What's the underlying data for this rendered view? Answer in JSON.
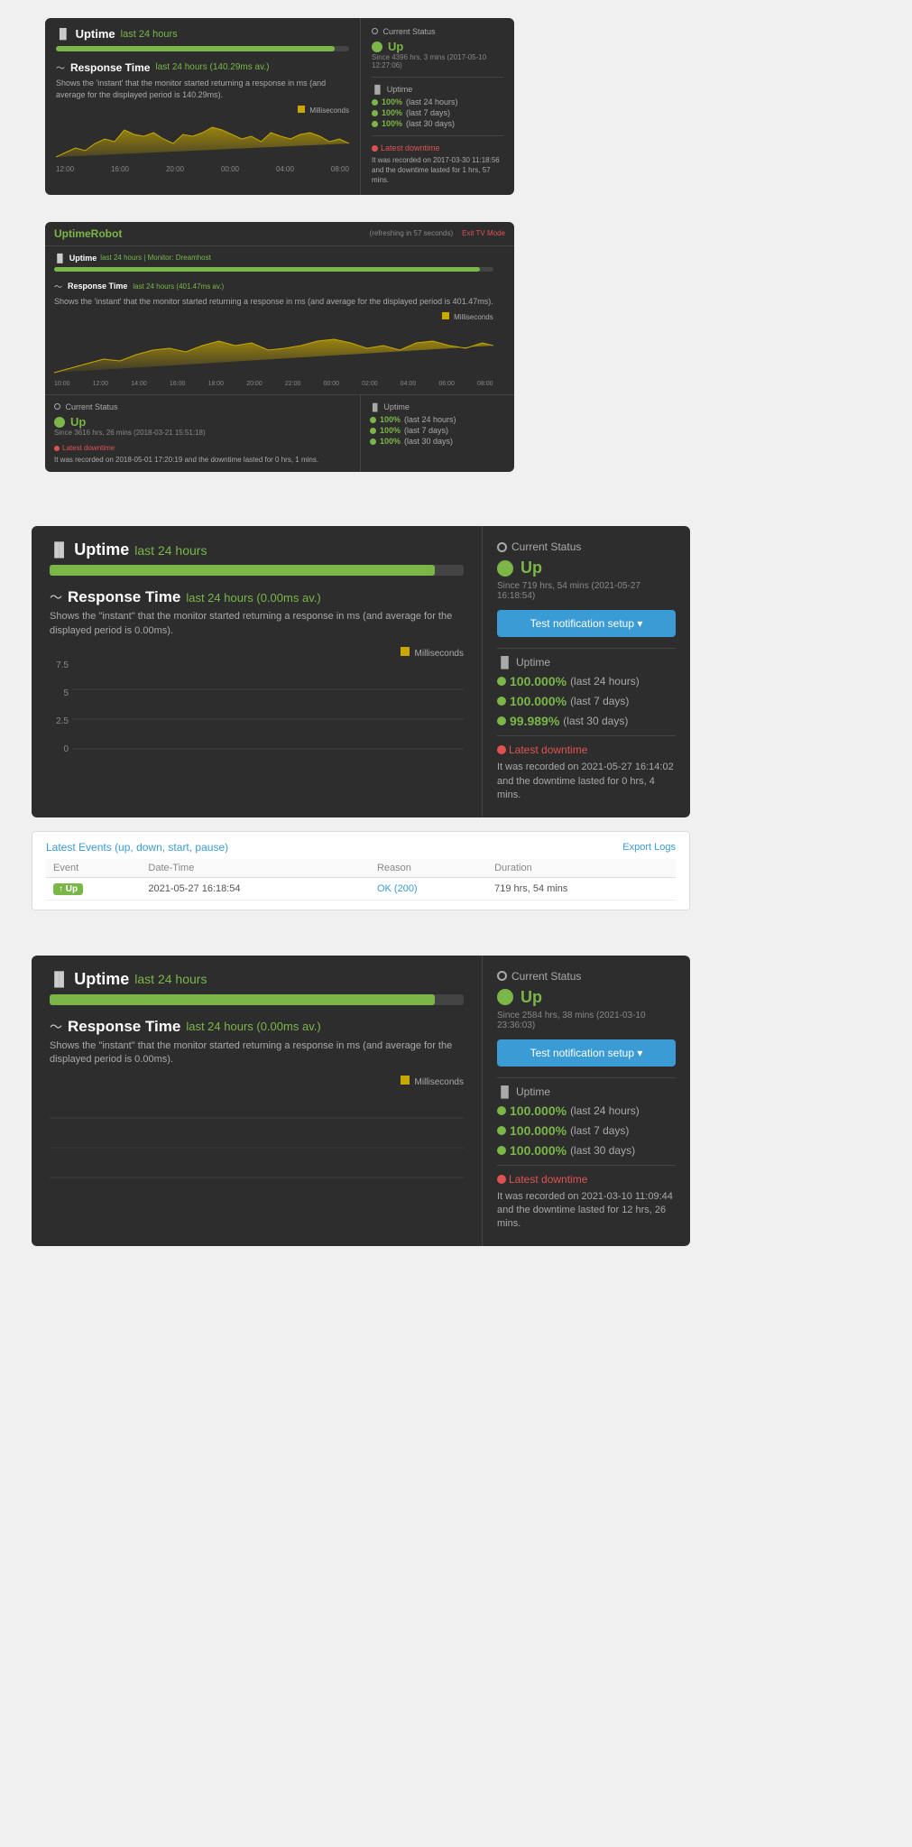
{
  "card1": {
    "uptime_title": "Uptime",
    "uptime_subtitle": "last 24 hours",
    "bar_width": "95%",
    "response_title": "Response Time",
    "response_subtitle": "last 24 hours (140.29ms av.)",
    "response_desc": "Shows the 'instant' that the monitor started returning a response in ms (and average for the displayed period is 140.29ms).",
    "ms_label": "Milliseconds",
    "chart_labels": [
      "12:00",
      "16:00",
      "20:00",
      "00:00",
      "04:00",
      "08:00"
    ],
    "current_status": "Current Status",
    "status": "Up",
    "since": "Since 4396 hrs, 3 mins (2017-05-10 12:27:06)",
    "uptime_section": "Uptime",
    "stats": [
      {
        "percent": "100%",
        "period": "(last 24 hours)"
      },
      {
        "percent": "100%",
        "period": "(last 7 days)"
      },
      {
        "percent": "100%",
        "period": "(last 30 days)"
      }
    ],
    "latest_downtime": "Latest downtime",
    "downtime_desc": "It was recorded on 2017-03-30 11:18:56 and the downtime lasted for 1 hrs, 57 mins."
  },
  "card2": {
    "logo": "UptimeRobot",
    "refreshing": "(refreshing in 57 seconds)",
    "exit_tv": "Exit TV Mode",
    "monitor": "Monitor: Dreamhost",
    "uptime_title": "Uptime",
    "uptime_subtitle": "last 24 hours",
    "bar_width": "97%",
    "response_title": "Response Time",
    "response_subtitle": "last 24 hours (401.47ms av.)",
    "response_desc": "Shows the 'instant' that the monitor started returning a response in ms (and average for the displayed period is 401.47ms).",
    "ms_label": "Milliseconds",
    "chart_labels": [
      "10:00",
      "12:00",
      "14:00",
      "16:00",
      "18:00",
      "20:00",
      "22:00",
      "00:00",
      "02:00",
      "04:00",
      "06:00",
      "08:00"
    ],
    "current_status": "Current Status",
    "status": "Up",
    "since": "Since 3616 hrs, 26 mins (2018-03-21 15:51:18)",
    "uptime_section": "Uptime",
    "stats": [
      {
        "percent": "100%",
        "period": "(last 24 hours)"
      },
      {
        "percent": "100%",
        "period": "(last 7 days)"
      },
      {
        "percent": "100%",
        "period": "(last 30 days)"
      }
    ],
    "latest_downtime": "Latest downtime",
    "downtime_desc": "It was recorded on 2018-05-01 17:20:19 and the downtime lasted for 0 hrs, 1 mins."
  },
  "card3": {
    "uptime_title": "Uptime",
    "uptime_subtitle": "last 24 hours",
    "bar_width": "93%",
    "response_title": "Response Time",
    "response_subtitle": "last 24 hours (0.00ms av.)",
    "response_desc": "Shows the \"instant\" that the monitor started returning a response in ms (and average for the displayed period is 0.00ms).",
    "ms_label": "Milliseconds",
    "y_labels": [
      "7.5",
      "5",
      "2.5",
      "0"
    ],
    "chart_labels": [],
    "current_status": "Current Status",
    "status": "Up",
    "since": "Since 719 hrs, 54 mins (2021-05-27 16:18:54)",
    "notification_btn": "Test notification setup ▾",
    "uptime_section": "Uptime",
    "stats": [
      {
        "percent": "100.000%",
        "period": "(last 24 hours)"
      },
      {
        "percent": "100.000%",
        "period": "(last 7 days)"
      },
      {
        "percent": "99.989%",
        "period": "(last 30 days)"
      }
    ],
    "latest_downtime": "Latest downtime",
    "downtime_desc": "It was recorded on 2021-05-27 16:14:02 and the downtime lasted for 0 hrs, 4 mins.",
    "events_title": "Latest Events",
    "events_filter": "(up, down, start, pause)",
    "export_logs": "Export Logs",
    "table_headers": [
      "Event",
      "Date-Time",
      "Reason",
      "Duration"
    ],
    "table_rows": [
      {
        "event": "Up",
        "datetime": "2021-05-27 16:18:54",
        "reason": "OK (200)",
        "duration": "719 hrs, 54 mins"
      }
    ]
  },
  "card4": {
    "uptime_title": "Uptime",
    "uptime_subtitle": "last 24 hours",
    "bar_width": "93%",
    "response_title": "Response Time",
    "response_subtitle": "last 24 hours (0.00ms av.)",
    "response_desc": "Shows the \"instant\" that the monitor started returning a response in ms (and average for the displayed period is 0.00ms).",
    "ms_label": "Milliseconds",
    "y_labels": [],
    "chart_labels": [],
    "current_status": "Current Status",
    "status": "Up",
    "since": "Since 2584 hrs, 38 mins (2021-03-10 23:36:03)",
    "notification_btn": "Test notification setup ▾",
    "uptime_section": "Uptime",
    "stats": [
      {
        "percent": "100.000%",
        "period": "(last 24 hours)"
      },
      {
        "percent": "100.000%",
        "period": "(last 7 days)"
      },
      {
        "percent": "100.000%",
        "period": "(last 30 days)"
      }
    ],
    "latest_downtime": "Latest downtime",
    "downtime_desc": "It was recorded on 2021-03-10 11:09:44 and the downtime lasted for 12 hrs, 26 mins."
  },
  "icons": {
    "bar_chart": "📊",
    "wave": "〜",
    "circle": "○",
    "dot_red": "🔴",
    "dot_green": "🟢",
    "bar_white": "▐"
  }
}
